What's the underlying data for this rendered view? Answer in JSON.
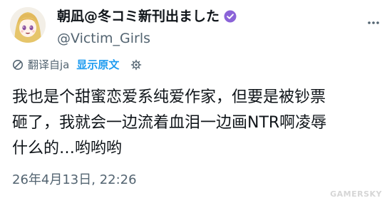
{
  "colors": {
    "text": "#0f1419",
    "secondary": "#536471",
    "accent": "#1d9bf0",
    "background": "#ffffff"
  },
  "author": {
    "display_name": "朝凪@冬コミ新刊出ました",
    "handle": "@Victim_Girls",
    "avatar_icon": "anime-avatar",
    "verified_icon": "verified-badge-icon"
  },
  "header": {
    "more_icon": "more-horizontal-icon"
  },
  "translation": {
    "icon": "translate-icon",
    "label": "翻译自ja",
    "show_original": "显示原文",
    "settings_icon": "gear-icon"
  },
  "tweet": {
    "lines": [
      "我也是个甜蜜恋爱系纯爱作家，但要是被钞票",
      "砸了，我就会一边流着血泪一边画NTR啊凌辱",
      "什么的…哟哟哟"
    ]
  },
  "timestamp": "26年4月13日, 22:26",
  "watermark": "GAMERSKY"
}
